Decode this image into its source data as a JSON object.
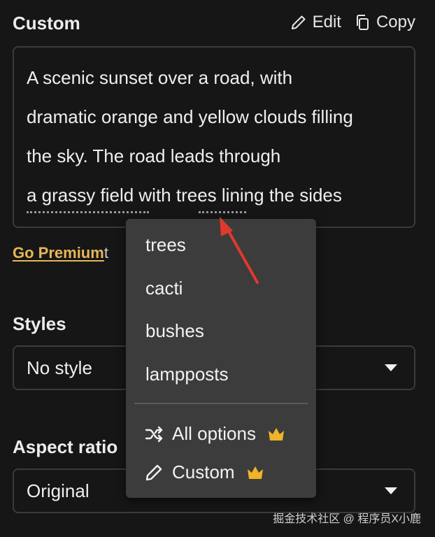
{
  "header": {
    "title": "Custom",
    "edit_label": "Edit",
    "copy_label": "Copy"
  },
  "prompt": {
    "lines": [
      "A scenic sunset over a road, with",
      "dramatic orange and yellow clouds filling",
      "the sky. The road leads through",
      "a grassy field with trees lining the sides"
    ]
  },
  "premium": {
    "link_label": "Go Premium",
    "rest_text": "t"
  },
  "styles": {
    "label": "Styles",
    "selected": "No style"
  },
  "aspect": {
    "label": "Aspect ratio",
    "selected": "Original"
  },
  "menu": {
    "items": [
      "trees",
      "cacti",
      "bushes",
      "lampposts"
    ],
    "all_options_label": "All options",
    "custom_label": "Custom"
  },
  "colors": {
    "background": "#161616",
    "accent": "#e6b756",
    "menu_bg": "#3c3c3c",
    "crown": "#f0b429",
    "annotation_arrow": "#e0392b"
  },
  "watermark": "掘金技术社区 @ 程序员X小鹿"
}
